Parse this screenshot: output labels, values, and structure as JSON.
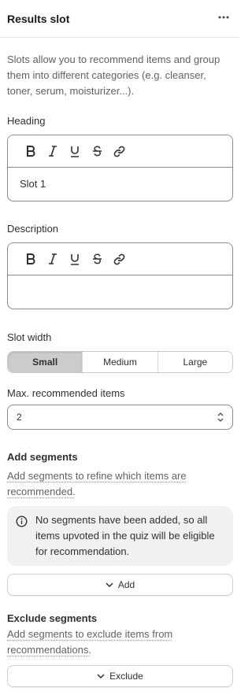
{
  "panel": {
    "title": "Results slot",
    "more_icon": "more-horizontal-icon"
  },
  "intro": "Slots allow you to recommend items and group them into different categories (e.g. cleanser, toner, serum, moisturizer...).",
  "heading": {
    "label": "Heading",
    "value": "Slot 1",
    "toolbar": [
      "bold-icon",
      "italic-icon",
      "underline-icon",
      "strikethrough-icon",
      "link-icon"
    ]
  },
  "description": {
    "label": "Description",
    "value": "",
    "toolbar": [
      "bold-icon",
      "italic-icon",
      "underline-icon",
      "strikethrough-icon",
      "link-icon"
    ]
  },
  "slot_width": {
    "label": "Slot width",
    "options": [
      "Small",
      "Medium",
      "Large"
    ],
    "selected": "Small"
  },
  "max_items": {
    "label": "Max. recommended items",
    "value": "2"
  },
  "add_segments": {
    "title": "Add segments",
    "help": "Add segments to refine which items are recommended.",
    "banner": "No segments have been added, so all items upvoted in the quiz will be eligible for recommendation.",
    "button": "Add"
  },
  "exclude_segments": {
    "title": "Exclude segments",
    "help": "Add segments to exclude items from recommendations.",
    "button": "Exclude"
  }
}
